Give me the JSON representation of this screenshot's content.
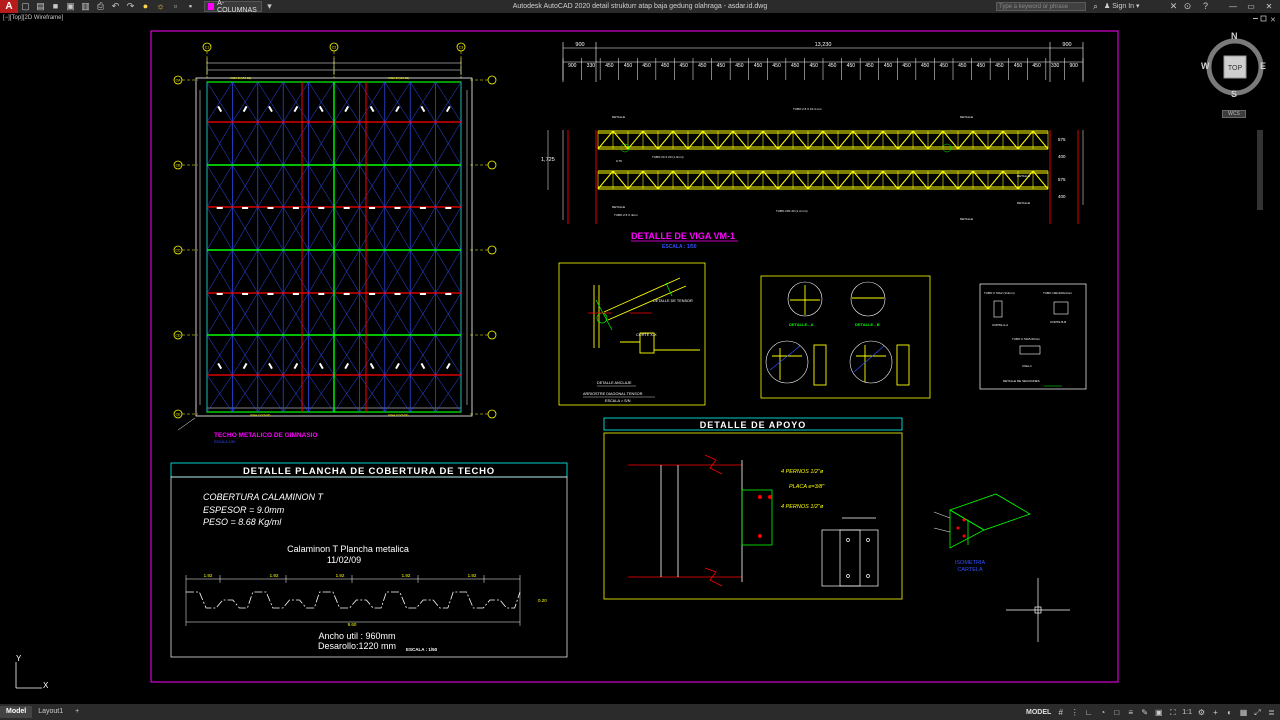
{
  "titlebar": {
    "app_logo": "A",
    "layer_name": "A-COLUMNAS",
    "document_title": "Autodesk AutoCAD 2020   detail strukturr atap baja gedung olahraga - asdar.id.dwg",
    "search_placeholder": "Type a keyword or phrase",
    "sign_in": "Sign In",
    "quick_access_icons": [
      "new-icon",
      "open-icon",
      "save-icon",
      "save-as-icon",
      "print-icon",
      "undo-icon",
      "redo-icon",
      "lightbulb-icon",
      "sun-icon",
      "lock-icon",
      "layer-icon"
    ]
  },
  "viewport": {
    "label": "[−][Top][2D Wireframe]"
  },
  "viewcube": {
    "n": "N",
    "s": "S",
    "e": "E",
    "w": "W",
    "face": "TOP",
    "wcs": "WCS"
  },
  "drawing": {
    "plan": {
      "title": "TECHO METALICO DE GIMNASIO",
      "subtitle": "ESCALA 1/50",
      "grid_cols": [
        "C1",
        "C2",
        "C3"
      ],
      "grid_rows": [
        "CA",
        "CB",
        "CC",
        "CD",
        "CE"
      ]
    },
    "beam": {
      "dim_overall": "13,230",
      "dim_end_left": "900",
      "dim_end_right": "900",
      "dim_sequence": [
        "900",
        "330",
        "450",
        "450",
        "450",
        "450",
        "450",
        "450",
        "450",
        "450",
        "450",
        "450",
        "450",
        "450",
        "450",
        "450",
        "450",
        "450",
        "450",
        "450",
        "450",
        "450",
        "450",
        "450",
        "450",
        "450",
        "330",
        "900"
      ],
      "height_dim": "1,725",
      "right_dims": [
        "575",
        "400",
        "575",
        "400"
      ],
      "title": "DETALLE DE VIGA VM-1",
      "scale": "ESCALA : 1/50"
    },
    "anchor_detail": {
      "label_tensor": "DETALLE DE TENSOR",
      "label_corte": "CORTE X-X",
      "label_anclaje": "DETALLE ANCLAJE",
      "label_arriostre": "ARRIOSTRE DIAGONAL TENSOR",
      "label_escala": "ESCALA = S/N"
    },
    "sections_detail": {
      "label_a": "DETALLE - A",
      "label_b": "DETALLE - B"
    },
    "sections_box": {
      "tubo_a": "TUBO C 50x2 (1/4mm)",
      "tubo_b": "TUBO 100x100x4mm",
      "corte_a": "CORTE A-A",
      "corte_b": "CORTE B-B",
      "tubo_c": "TUBO C 50x5.00mm",
      "corte_c": "VIGA-1",
      "title": "DETALLE DE SECCIONES"
    },
    "cover": {
      "title": "DETALLE PLANCHA DE COBERTURA DE TECHO",
      "line1": "COBERTURA  CALAMINON  T",
      "line2": "ESPESOR  =  9.0mm",
      "line3": "PESO  =  8.68  Kg/ml",
      "product": "Calaminon T Plancha metalica",
      "date": "11/02/09",
      "dims": [
        "1.92",
        "1.92",
        "1.92",
        "1.92",
        "1.92"
      ],
      "total": "9.60",
      "height": "0.20",
      "width_util": "Ancho util : 960mm",
      "desarrollo": "Desarollo:1220 mm",
      "scale": "ESCALA : 1/50"
    },
    "support": {
      "title": "DETALLE DE APOYO",
      "note1": "4  PERNOS  1/2\"ø",
      "note2": "PLACA  e=3/8\"",
      "note3": "4  PERNOS  1/2\"ø"
    },
    "iso": {
      "label1": "ISOMETRIA",
      "label2": "CARTELA"
    },
    "ucs": {
      "x": "X",
      "y": "Y"
    }
  },
  "statusbar": {
    "tabs": [
      "Model",
      "Layout1"
    ],
    "add_tab": "+",
    "model_label": "MODEL",
    "scale": "1:1"
  },
  "colors": {
    "background": "#000000",
    "magenta": "#ff00ff",
    "yellow": "#ffff00",
    "red": "#ff0000",
    "blue": "#3050ff",
    "green": "#00ff00",
    "cyan": "#00ffff",
    "white": "#ffffff"
  }
}
